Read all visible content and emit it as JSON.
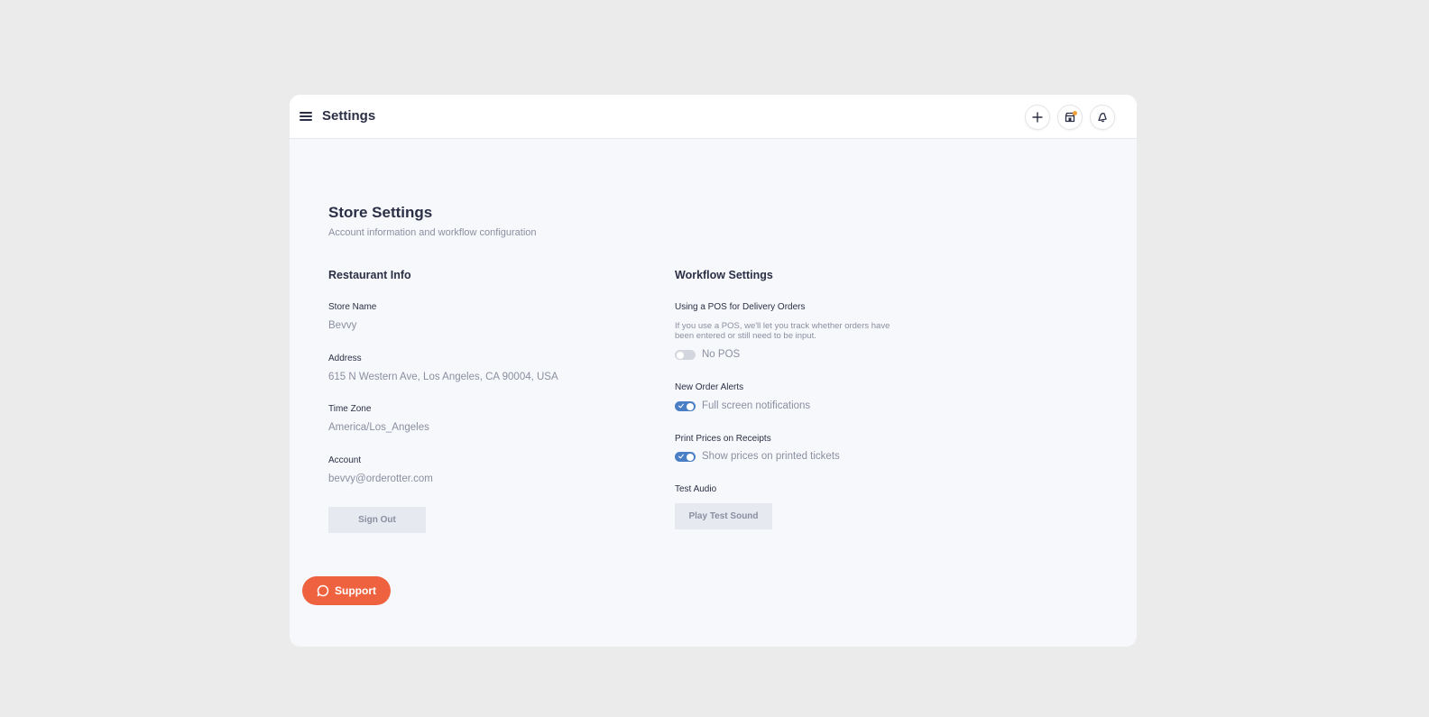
{
  "header": {
    "title": "Settings",
    "icons": [
      "menu-icon",
      "plus-icon",
      "store-icon",
      "bell-icon"
    ],
    "store_badge_color": "#f0a33a"
  },
  "page": {
    "heading": "Store Settings",
    "subtitle": "Account information and workflow configuration"
  },
  "restaurant_info": {
    "title": "Restaurant Info",
    "store_name_label": "Store Name",
    "store_name_value": "Bevvy",
    "address_label": "Address",
    "address_value": "615 N Western Ave, Los Angeles, CA 90004, USA",
    "timezone_label": "Time Zone",
    "timezone_value": "America/Los_Angeles",
    "account_label": "Account",
    "account_value": "bevvy@orderotter.com",
    "sign_out_label": "Sign Out"
  },
  "workflow_settings": {
    "title": "Workflow Settings",
    "pos_label": "Using a POS for Delivery Orders",
    "pos_help": "If you use a POS, we'll let you track whether orders have been entered or still need to be input.",
    "pos_toggle_label": "No POS",
    "pos_toggle_on": false,
    "alerts_label": "New Order Alerts",
    "alerts_toggle_label": "Full screen notifications",
    "alerts_toggle_on": true,
    "print_label": "Print Prices on Receipts",
    "print_toggle_label": "Show prices on printed tickets",
    "print_toggle_on": true,
    "audio_label": "Test Audio",
    "audio_button_label": "Play Test Sound"
  },
  "support": {
    "label": "Support",
    "color": "#ee6240"
  },
  "colors": {
    "accent": "#4a7fc6",
    "text": "#2b2f45",
    "muted": "#8a8fa0"
  }
}
